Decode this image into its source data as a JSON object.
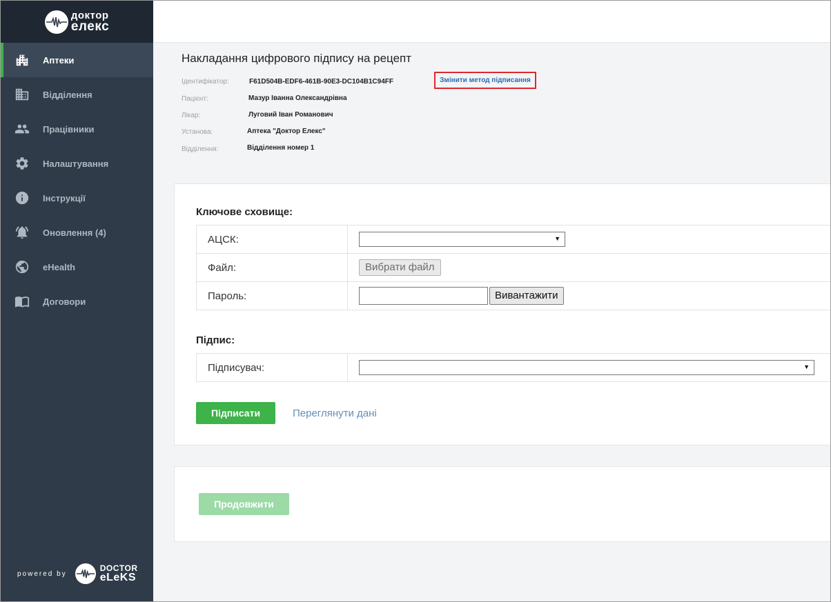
{
  "brand": {
    "logo_line1": "доктор",
    "logo_line2": "елекс",
    "powered_label": "powered by",
    "powered_line1": "DOCTOR",
    "powered_line2": "eLeKS"
  },
  "sidebar": {
    "items": [
      {
        "label": "Аптеки",
        "icon": "pharmacy-building-icon",
        "active": true
      },
      {
        "label": "Відділення",
        "icon": "department-building-icon"
      },
      {
        "label": "Працівники",
        "icon": "people-icon"
      },
      {
        "label": "Налаштування",
        "icon": "gear-icon"
      },
      {
        "label": "Інструкції",
        "icon": "info-icon"
      },
      {
        "label": "Оновлення (4)",
        "icon": "bell-alert-icon"
      },
      {
        "label": "eHealth",
        "icon": "globe-icon"
      },
      {
        "label": "Договори",
        "icon": "book-icon"
      }
    ]
  },
  "header": {
    "title": "Накладання цифрового підпису на рецепт",
    "change_method": "Змінити метод підписання",
    "fields": [
      {
        "label": "Ідентифікатор:",
        "value": "F61D504B-EDF6-461B-90E3-DC104B1C94FF"
      },
      {
        "label": "Пацієнт:",
        "value": "Мазур Іванна Олександрівна"
      },
      {
        "label": "Лікар:",
        "value": "Луговий Іван Романович"
      },
      {
        "label": "Установа:",
        "value": "Аптека \"Доктор Елекс\""
      },
      {
        "label": "Відділення:",
        "value": "Відділення номер 1"
      }
    ]
  },
  "keystore": {
    "title": "Ключове сховище:",
    "acsk_label": "АЦСК:",
    "acsk_value": "",
    "file_label": "Файл:",
    "file_button": "Вибрати файл",
    "password_label": "Пароль:",
    "password_value": "",
    "upload_button": "Вивантажити"
  },
  "signature": {
    "title": "Підпис:",
    "signer_label": "Підписувач:",
    "signer_value": ""
  },
  "actions": {
    "sign": "Підписати",
    "view_data": "Переглянути дані",
    "continue": "Продовжити"
  },
  "colors": {
    "sidebar_bg": "#2f3b48",
    "accent_green": "#3db34a",
    "highlight_red": "#e0262b",
    "link_blue": "#5d8fb9"
  }
}
